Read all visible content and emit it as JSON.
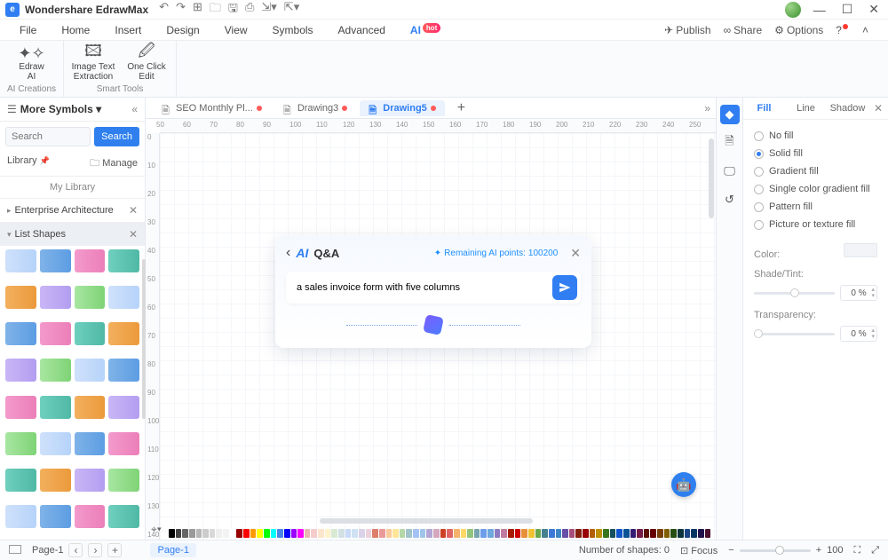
{
  "app": {
    "name": "Wondershare EdrawMax"
  },
  "menu": {
    "file": "File",
    "home": "Home",
    "insert": "Insert",
    "design": "Design",
    "view": "View",
    "symbols": "Symbols",
    "advanced": "Advanced",
    "ai": "AI",
    "hot": "hot",
    "publish": "Publish",
    "share": "Share",
    "options": "Options"
  },
  "ribbon": {
    "edraw_ai": "Edraw\nAI",
    "image_text": "Image Text\nExtraction",
    "one_click": "One Click\nEdit",
    "group1": "AI Creations",
    "group2": "Smart Tools"
  },
  "left": {
    "title": "More Symbols",
    "search_placeholder": "Search",
    "search_btn": "Search",
    "library": "Library",
    "manage": "Manage",
    "mylib": "My Library",
    "cat_enterprise": "Enterprise Architecture",
    "cat_list": "List Shapes"
  },
  "tabs": {
    "t1": "SEO Monthly Pl...",
    "t2": "Drawing3",
    "t3": "Drawing5"
  },
  "ruler_h": [
    50,
    60,
    70,
    80,
    90,
    100,
    110,
    120,
    130,
    140,
    150,
    160,
    170,
    180,
    190,
    200,
    210,
    220,
    230,
    240,
    250
  ],
  "ruler_v": [
    0,
    10,
    20,
    30,
    40,
    50,
    60,
    70,
    80,
    90,
    100,
    110,
    120,
    130,
    140
  ],
  "ai_dialog": {
    "ai": "AI",
    "qa": "Q&A",
    "points_label": "Remaining AI points:",
    "points_value": "100200",
    "prompt": "a sales invoice form with five columns"
  },
  "prop": {
    "tab_fill": "Fill",
    "tab_line": "Line",
    "tab_shadow": "Shadow",
    "no_fill": "No fill",
    "solid": "Solid fill",
    "gradient": "Gradient fill",
    "single_grad": "Single color gradient fill",
    "pattern": "Pattern fill",
    "picture": "Picture or texture fill",
    "color": "Color:",
    "shade": "Shade/Tint:",
    "transparency": "Transparency:",
    "pct": "0 %"
  },
  "status": {
    "page": "Page-1",
    "active_page": "Page-1",
    "shapes_label": "Number of shapes:",
    "shapes_count": "0",
    "focus": "Focus",
    "zoom": "100"
  },
  "palette": [
    "#000000",
    "#434343",
    "#666666",
    "#999999",
    "#b7b7b7",
    "#cccccc",
    "#d9d9d9",
    "#efefef",
    "#f3f3f3",
    "#ffffff",
    "#980000",
    "#ff0000",
    "#ff9900",
    "#ffff00",
    "#00ff00",
    "#00ffff",
    "#4a86e8",
    "#0000ff",
    "#9900ff",
    "#ff00ff",
    "#e6b8af",
    "#f4cccc",
    "#fce5cd",
    "#fff2cc",
    "#d9ead3",
    "#d0e0e3",
    "#c9daf8",
    "#cfe2f3",
    "#d9d2e9",
    "#ead1dc",
    "#dd7e6b",
    "#ea9999",
    "#f9cb9c",
    "#ffe599",
    "#b6d7a8",
    "#a2c4c9",
    "#a4c2f4",
    "#9fc5e8",
    "#b4a7d6",
    "#d5a6bd",
    "#cc4125",
    "#e06666",
    "#f6b26b",
    "#ffd966",
    "#93c47d",
    "#76a5af",
    "#6d9eeb",
    "#6fa8dc",
    "#8e7cc3",
    "#c27ba0",
    "#a61c00",
    "#cc0000",
    "#e69138",
    "#f1c232",
    "#6aa84f",
    "#45818e",
    "#3c78d8",
    "#3d85c6",
    "#674ea7",
    "#a64d79",
    "#85200c",
    "#990000",
    "#b45f06",
    "#bf9000",
    "#38761d",
    "#134f5c",
    "#1155cc",
    "#0b5394",
    "#351c75",
    "#741b47",
    "#5b0f00",
    "#660000",
    "#783f04",
    "#7f6000",
    "#274e13",
    "#0c343d",
    "#1c4587",
    "#073763",
    "#20124d",
    "#4c1130"
  ]
}
